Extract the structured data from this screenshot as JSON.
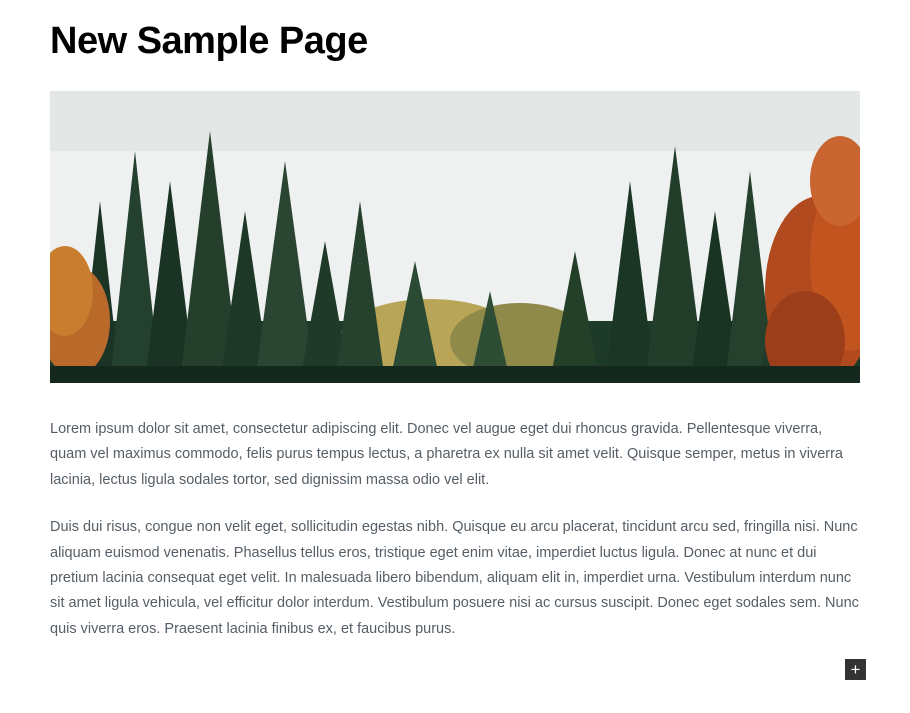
{
  "title": "New Sample Page",
  "paragraphs": [
    "Lorem ipsum dolor sit amet, consectetur adipiscing elit. Donec vel augue eget dui rhoncus gravida. Pellentesque viverra, quam vel maximus commodo, felis purus tempus lectus, a pharetra ex nulla sit amet velit. Quisque semper, metus in viverra lacinia, lectus ligula sodales tortor, sed dignissim massa odio vel elit.",
    "Duis dui risus, congue non velit eget, sollicitudin egestas nibh. Quisque eu arcu placerat, tincidunt arcu sed, fringilla nisi. Nunc aliquam euismod venenatis. Phasellus tellus eros, tristique eget enim vitae, imperdiet luctus ligula. Donec at nunc et dui pretium lacinia consequat eget velit. In malesuada libero bibendum, aliquam elit in, imperdiet urna. Vestibulum interdum nunc sit amet ligula vehicula, vel efficitur dolor interdum. Vestibulum posuere nisi ac cursus suscipit. Donec eget sodales sem. Nunc quis viverra eros. Praesent lacinia finibus ex, et faucibus purus."
  ],
  "add_button_glyph": "+"
}
